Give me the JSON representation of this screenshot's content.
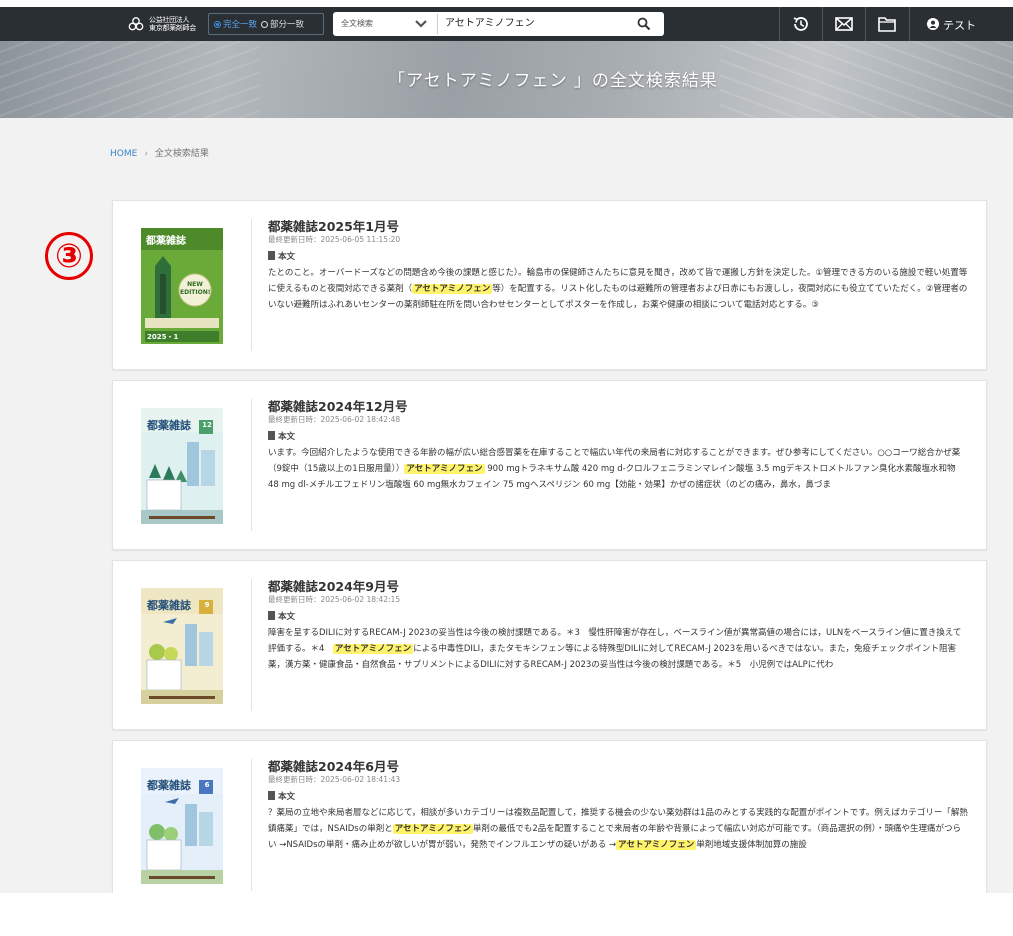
{
  "header": {
    "logo_line1": "公益社団法人",
    "logo_line2": "東京都薬剤師会",
    "match_modes": [
      {
        "label": "完全一致",
        "selected": true
      },
      {
        "label": "部分一致",
        "selected": false
      }
    ],
    "search_scope": "全文検索",
    "search_query": "アセトアミノフェン",
    "icons": [
      "history-icon",
      "mail-icon",
      "folder-icon"
    ],
    "user_name": "テスト"
  },
  "hero": {
    "title": "「アセトアミノフェン 」の全文検索結果"
  },
  "breadcrumb": {
    "home": "HOME",
    "separator": "›",
    "current": "全文検索結果"
  },
  "step_marker": "③",
  "section_label": "本文",
  "results": [
    {
      "title": "都薬雑誌2025年1月号",
      "updated": "最終更新日時：2025-06-05 11:15:20",
      "cover_style": "new-edition",
      "cover_title": "都薬雑誌",
      "cover_badge": "NEW EDITION!",
      "cover_issue": "2025・1",
      "snippet": [
        {
          "text": "たとのこと。オーバードーズなどの問題含め今後の課題と感じた）。輪島市の保健師さんたちに意見を聞き，改めて皆で運搬し方針を決定した。①管理できる方のいる施設で軽い処置等に使えるものと夜間対応できる薬剤（",
          "hl": false
        },
        {
          "text": "アセトアミノフェン",
          "hl": true
        },
        {
          "text": "等）を配置する。リスト化したものは避難所の管理者および日赤にもお渡しし，夜間対応にも役立てていただく。②管理者のいない避難所はふれあいセンターの薬剤師駐在所を問い合わせセンターとしてポスターを作成し，お薬や健康の相談について電話対応とする。③",
          "hl": false
        }
      ]
    },
    {
      "title": "都薬雑誌2024年12月号",
      "updated": "最終更新日時：2025-06-02 18:42:48",
      "cover_style": "winter",
      "cover_title": "都薬雑誌",
      "cover_issue": "12",
      "snippet": [
        {
          "text": "います。今回紹介したような使用できる年齢の幅が広い総合感冒薬を在庫することで幅広い年代の来局者に対応することができます。ぜひ参考にしてください。○○コーワ総合かぜ薬（9錠中（15歳以上の1日服用量））",
          "hl": false
        },
        {
          "text": "アセトアミノフェン",
          "hl": true
        },
        {
          "text": " 900 mgトラネキサム酸 420 mg d-クロルフェニラミンマレイン酸塩 3.5 mgデキストロメトルファン臭化水素酸塩水和物　48 mg dl-メチルエフェドリン塩酸塩 60 mg無水カフェイン 75 mgヘスペリジン 60 mg【効能・効果】かぜの諸症状（のどの痛み，鼻水，鼻づま",
          "hl": false
        }
      ]
    },
    {
      "title": "都薬雑誌2024年9月号",
      "updated": "最終更新日時：2025-06-02 18:42:15",
      "cover_style": "autumn",
      "cover_title": "都薬雑誌",
      "cover_issue": "9",
      "snippet": [
        {
          "text": "障害を呈するDILIに対するRECAM-J 2023の妥当性は今後の検討課題である。＊3　慢性肝障害が存在し，ベースライン値が異常高値の場合には，ULNをベースライン値に置き換えて評価する。＊4　",
          "hl": false
        },
        {
          "text": "アセトアミノフェン",
          "hl": true
        },
        {
          "text": "による中毒性DILI，またタモキシフェン等による特殊型DILIに対してRECAM-J 2023を用いるべきではない。また，免疫チェックポイント阻害薬，漢方薬・健康食品・自然食品・サプリメントによるDILIに対するRECAM-J 2023の妥当性は今後の検討課題である。＊5　小児例ではALPに代わ",
          "hl": false
        }
      ]
    },
    {
      "title": "都薬雑誌2024年6月号",
      "updated": "最終更新日時：2025-06-02 18:41:43",
      "cover_style": "spring",
      "cover_title": "都薬雑誌",
      "cover_issue": "6",
      "snippet": [
        {
          "text": "？薬局の立地や来局者層などに応じて，相談が多いカテゴリーは複数品配置して，推奨する機会の少ない薬効群は1品のみとする実践的な配置がポイントです。例えばカテゴリー「解熱鎮痛薬」では，NSAIDsの単剤と",
          "hl": false
        },
        {
          "text": "アセトアミノフェン",
          "hl": true
        },
        {
          "text": "単剤の最低でも2品を配置することで来局者の年齢や背景によって幅広い対応が可能です。（商品選択の例）・頭痛や生理痛がつらい →NSAIDsの単剤・痛み止めが欲しいが胃が弱い，発熱でインフルエンザの疑いがある →",
          "hl": false
        },
        {
          "text": "アセトアミノフェン",
          "hl": true
        },
        {
          "text": "単剤地域支援体制加算の施設",
          "hl": false
        }
      ]
    }
  ]
}
